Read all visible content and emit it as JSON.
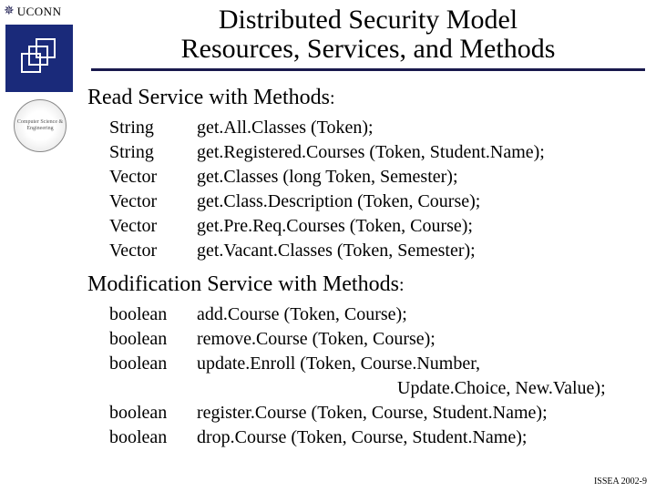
{
  "logos": {
    "uconn_label": "UCONN",
    "oak_glyph": "✵",
    "seal_text": "Computer Science & Engineering"
  },
  "title": {
    "line1": "Distributed Security Model",
    "line2": "Resources, Services, and Methods"
  },
  "sections": {
    "read": {
      "heading": "Read Service with Methods",
      "colon": ":",
      "rows": [
        {
          "ret": "String",
          "sig": "get.All.Classes (Token);"
        },
        {
          "ret": "String",
          "sig": "get.Registered.Courses (Token, Student.Name);"
        },
        {
          "ret": "Vector",
          "sig": "get.Classes (long Token, Semester);"
        },
        {
          "ret": "Vector",
          "sig": "get.Class.Description (Token, Course);"
        },
        {
          "ret": "Vector",
          "sig": "get.Pre.Req.Courses (Token, Course);"
        },
        {
          "ret": "Vector",
          "sig": "get.Vacant.Classes (Token,  Semester);"
        }
      ]
    },
    "mod": {
      "heading": "Modification Service with Methods",
      "colon": ":",
      "rows": [
        {
          "ret": "boolean",
          "sig": "add.Course (Token, Course);"
        },
        {
          "ret": "boolean",
          "sig": "remove.Course (Token, Course);"
        },
        {
          "ret": "boolean",
          "sig": "update.Enroll (Token, Course.Number,"
        },
        {
          "ret": "",
          "sig_cont": "Update.Choice,  New.Value);"
        },
        {
          "ret": "boolean",
          "sig": "register.Course (Token, Course, Student.Name);"
        },
        {
          "ret": "boolean",
          "sig": "drop.Course (Token, Course, Student.Name);"
        }
      ]
    }
  },
  "footer": "ISSEA 2002-9"
}
